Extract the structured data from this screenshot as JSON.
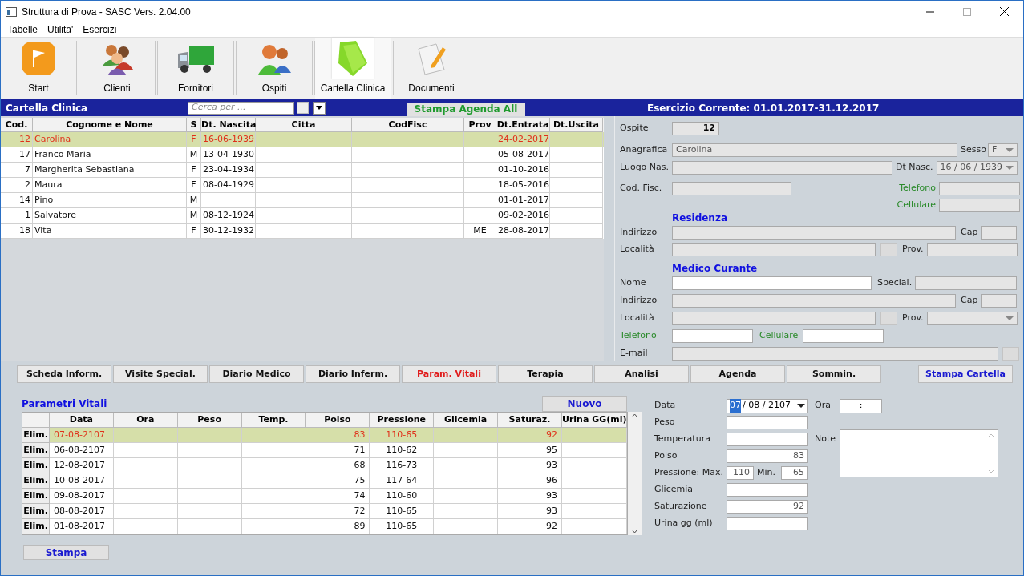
{
  "window": {
    "title": "Struttura di Prova - SASC Vers. 2.04.00"
  },
  "menu": [
    "Tabelle",
    "Utilita'",
    "Esercizi"
  ],
  "toolbar": [
    {
      "label": "Start",
      "kind": "flag",
      "selected": false
    },
    {
      "label": "Clienti",
      "kind": "people",
      "selected": false
    },
    {
      "label": "Fornitori",
      "kind": "truck",
      "selected": false
    },
    {
      "label": "Ospiti",
      "kind": "guests",
      "selected": false
    },
    {
      "label": "Cartella Clinica",
      "kind": "folder",
      "selected": true
    },
    {
      "label": "Documenti",
      "kind": "document",
      "selected": false
    }
  ],
  "header": {
    "title": "Cartella Clinica",
    "search_placeholder": "Cerca per ...",
    "search_checked": false,
    "print_button": "Stampa Agenda All",
    "period": "Esercizio Corrente: 01.01.2017-31.12.2017"
  },
  "guests_table": {
    "columns": [
      "Cod.",
      "Cognome e Nome",
      "S",
      "Dt. Nascita",
      "Citta",
      "CodFisc",
      "Prov",
      "Dt.Entrata",
      "Dt.Uscita"
    ],
    "rows": [
      {
        "selected": true,
        "cells": [
          "12",
          "Carolina",
          "F",
          "16-06-1939",
          "",
          "",
          "",
          "24-02-2017",
          ""
        ]
      },
      {
        "selected": false,
        "cells": [
          "17",
          "Franco Maria",
          "M",
          "13-04-1930",
          "",
          "",
          "",
          "05-08-2017",
          ""
        ]
      },
      {
        "selected": false,
        "cells": [
          "7",
          "Margherita Sebastiana",
          "F",
          "23-04-1934",
          "",
          "",
          "",
          "01-10-2016",
          ""
        ]
      },
      {
        "selected": false,
        "cells": [
          "2",
          "Maura",
          "F",
          "08-04-1929",
          "",
          "",
          "",
          "18-05-2016",
          ""
        ]
      },
      {
        "selected": false,
        "cells": [
          "14",
          "Pino",
          "M",
          "",
          "",
          "",
          "",
          "01-01-2017",
          ""
        ]
      },
      {
        "selected": false,
        "cells": [
          "1",
          "Salvatore",
          "M",
          "08-12-1924",
          "",
          "",
          "",
          "09-02-2016",
          ""
        ]
      },
      {
        "selected": false,
        "cells": [
          "18",
          "Vita",
          "F",
          "30-12-1932",
          "",
          "",
          "ME",
          "28-08-2017",
          ""
        ]
      }
    ]
  },
  "guest_form": {
    "ospite": {
      "label": "Ospite",
      "value": "12"
    },
    "anagrafica": {
      "label": "Anagrafica",
      "value": "Carolina",
      "disabled": true
    },
    "sesso": {
      "label": "Sesso",
      "value": "F",
      "disabled": true
    },
    "luogo_nas": {
      "label": "Luogo Nas.",
      "disabled": true
    },
    "dt_nasc": {
      "label": "Dt Nasc.",
      "value": "16 / 06 / 1939",
      "disabled": true
    },
    "cod_fisc": {
      "label": "Cod. Fisc.",
      "disabled": true
    },
    "telefono": {
      "label": "Telefono",
      "disabled": true
    },
    "cellulare": {
      "label": "Cellulare",
      "disabled": true
    },
    "residenza": {
      "title": "Residenza",
      "indirizzo": {
        "label": "Indirizzo",
        "disabled": true
      },
      "cap": {
        "label": "Cap",
        "disabled": true
      },
      "localita": {
        "label": "Località",
        "disabled": true
      },
      "prov": {
        "label": "Prov.",
        "disabled": true
      }
    },
    "medico": {
      "title": "Medico Curante",
      "nome": {
        "label": "Nome",
        "disabled": false
      },
      "special": {
        "label": "Special.",
        "disabled": true
      },
      "indirizzo": {
        "label": "Indirizzo",
        "disabled": true
      },
      "cap": {
        "label": "Cap",
        "disabled": true
      },
      "localita": {
        "label": "Località",
        "disabled": true
      },
      "prov": {
        "label": "Prov.",
        "disabled": true
      },
      "telefono": {
        "label": "Telefono",
        "disabled": false
      },
      "cellulare": {
        "label": "Cellulare",
        "disabled": false
      },
      "email": {
        "label": "E-mail",
        "disabled": true
      }
    }
  },
  "tabs": [
    {
      "label": "Scheda Inform.",
      "selected": false
    },
    {
      "label": "Visite Special.",
      "selected": false
    },
    {
      "label": "Diario Medico",
      "selected": false
    },
    {
      "label": "Diario Inferm.",
      "selected": false
    },
    {
      "label": "Param. Vitali",
      "selected": true
    },
    {
      "label": "Terapia",
      "selected": false
    },
    {
      "label": "Analisi",
      "selected": false
    },
    {
      "label": "Agenda",
      "selected": false
    },
    {
      "label": "Sommin.",
      "selected": false
    }
  ],
  "print_record_button": "Stampa Cartella",
  "vitals": {
    "title": "Parametri Vitali",
    "new_button": "Nuovo",
    "print_button": "Stampa",
    "columns": [
      "Data",
      "Ora",
      "Peso",
      "Temp.",
      "Polso",
      "Pressione",
      "Glicemia",
      "Saturaz.",
      "Urina GG(ml)"
    ],
    "rows": [
      {
        "delete": "Elim.",
        "selected": true,
        "cells": [
          "07-08-2107",
          "",
          "",
          "",
          "83",
          "110-65",
          "",
          "92",
          ""
        ]
      },
      {
        "delete": "Elim.",
        "selected": false,
        "cells": [
          "06-08-2107",
          "",
          "",
          "",
          "71",
          "110-62",
          "",
          "95",
          ""
        ]
      },
      {
        "delete": "Elim.",
        "selected": false,
        "cells": [
          "12-08-2017",
          "",
          "",
          "",
          "68",
          "116-73",
          "",
          "93",
          ""
        ]
      },
      {
        "delete": "Elim.",
        "selected": false,
        "cells": [
          "10-08-2017",
          "",
          "",
          "",
          "75",
          "117-64",
          "",
          "96",
          ""
        ]
      },
      {
        "delete": "Elim.",
        "selected": false,
        "cells": [
          "09-08-2017",
          "",
          "",
          "",
          "74",
          "110-60",
          "",
          "93",
          ""
        ]
      },
      {
        "delete": "Elim.",
        "selected": false,
        "cells": [
          "08-08-2017",
          "",
          "",
          "",
          "72",
          "110-65",
          "",
          "93",
          ""
        ]
      },
      {
        "delete": "Elim.",
        "selected": false,
        "cells": [
          "01-08-2017",
          "",
          "",
          "",
          "89",
          "110-65",
          "",
          "92",
          ""
        ]
      }
    ]
  },
  "vitals_form": {
    "data": {
      "label": "Data",
      "selected_part": "07",
      "rest": "/ 08 / 2107"
    },
    "ora": {
      "label": "Ora",
      "value": ":"
    },
    "peso": {
      "label": "Peso"
    },
    "temperatura": {
      "label": "Temperatura"
    },
    "polso": {
      "label": "Polso",
      "value": "83"
    },
    "pressione": {
      "label": "Pressione: Max.",
      "max": "110",
      "min_label": "Min.",
      "min": "65"
    },
    "glicemia": {
      "label": "Glicemia"
    },
    "saturazione": {
      "label": "Saturazione",
      "value": "92"
    },
    "urina": {
      "label": "Urina gg (ml)"
    },
    "note": {
      "label": "Note"
    }
  }
}
